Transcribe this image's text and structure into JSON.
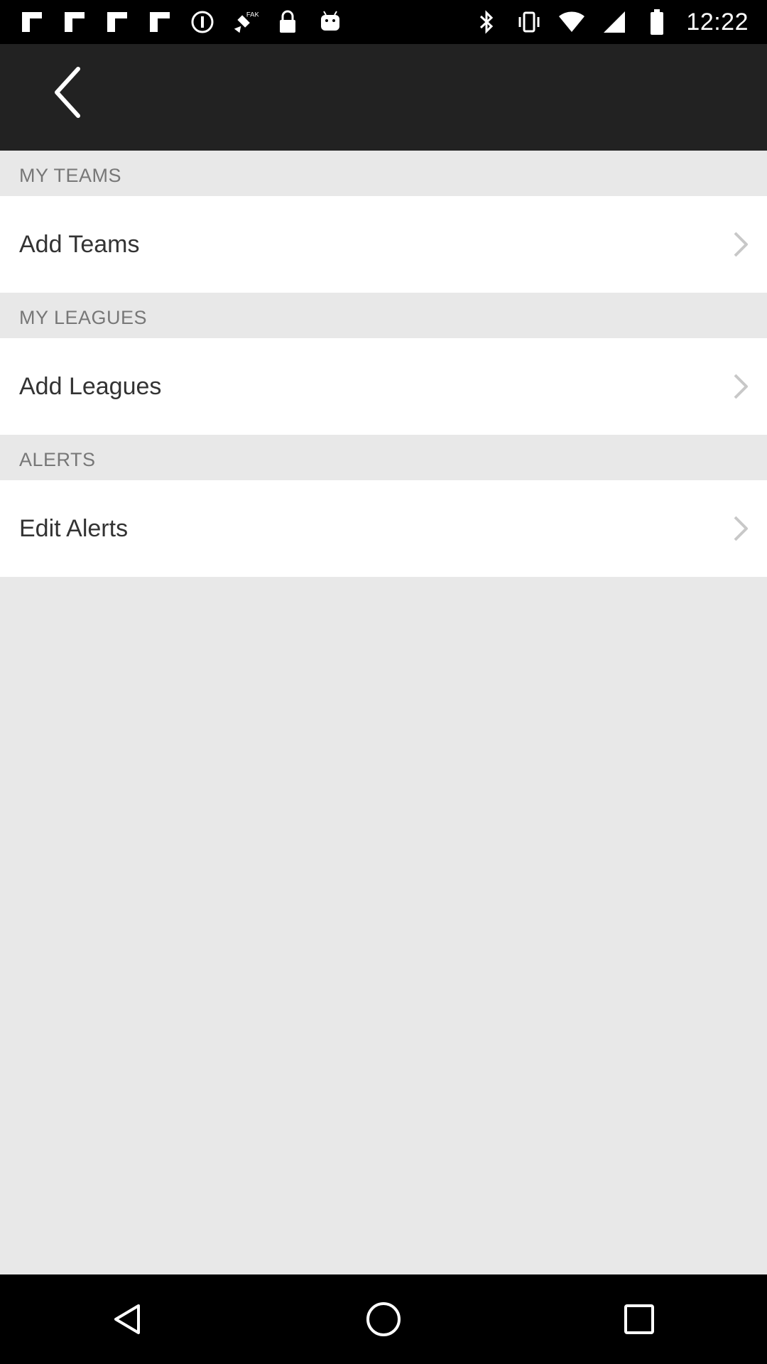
{
  "status_bar": {
    "time": "12:22",
    "icons_left": [
      "flipboard-icon",
      "flipboard-icon",
      "flipboard-icon",
      "flipboard-icon",
      "circle-icon",
      "fake-gps-icon",
      "lock-icon",
      "android-icon"
    ],
    "icons_right": [
      "bluetooth-icon",
      "vibrate-icon",
      "wifi-icon",
      "signal-icon",
      "battery-icon"
    ]
  },
  "sections": [
    {
      "header": "MY TEAMS",
      "item": "Add Teams"
    },
    {
      "header": "MY LEAGUES",
      "item": "Add Leagues"
    },
    {
      "header": "ALERTS",
      "item": "Edit Alerts"
    }
  ],
  "colors": {
    "app_bar": "#222222",
    "background": "#e8e8e8",
    "row": "#ffffff"
  }
}
